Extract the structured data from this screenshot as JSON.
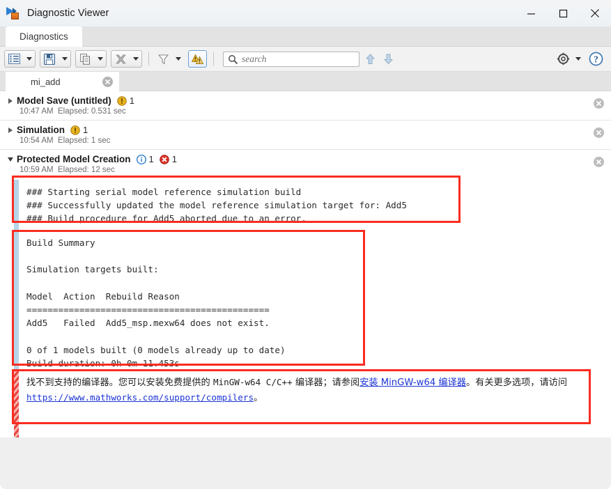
{
  "window": {
    "title": "Diagnostic Viewer",
    "controls": {
      "minimize": "—",
      "maximize": "□",
      "close": "✕"
    }
  },
  "tabs": {
    "main": "Diagnostics"
  },
  "toolbar": {
    "view_label": "view-options",
    "save_label": "save",
    "copy_label": "copy",
    "clear_label": "clear",
    "filter_label": "filter",
    "warnings_label": "warnings-errors",
    "settings_label": "settings",
    "help_label": "help",
    "search_placeholder": "search",
    "search_value": "",
    "prev_label": "previous-match",
    "next_label": "next-match"
  },
  "subtab": {
    "label": "mi_add",
    "close": "close"
  },
  "entries": [
    {
      "title": "Model Save (untitled)",
      "badges": [
        {
          "type": "warning",
          "count": "1"
        }
      ],
      "time": "10:47 AM",
      "elapsed": "Elapsed: 0.531 sec",
      "expanded": false
    },
    {
      "title": "Simulation",
      "badges": [
        {
          "type": "warning",
          "count": "1"
        }
      ],
      "time": "10:54 AM",
      "elapsed": "Elapsed: 1 sec",
      "expanded": false
    },
    {
      "title": "Protected Model Creation",
      "badges": [
        {
          "type": "info",
          "count": "1"
        },
        {
          "type": "error",
          "count": "1"
        }
      ],
      "time": "10:59 AM",
      "elapsed": "Elapsed: 12 sec",
      "expanded": true
    }
  ],
  "messages": {
    "build_log": "### Starting serial model reference simulation build\n### Successfully updated the model reference simulation target for: Add5\n### Build procedure for Add5 aborted due to an error.",
    "build_summary": "Build Summary\n\nSimulation targets built:\n\nModel  Action  Rebuild Reason\n==============================================\nAdd5   Failed  Add5_msp.mexw64 does not exist.\n\n0 of 1 models built (0 models already up to date)\nBuild duration: 0h 0m 11.453s",
    "error": {
      "part1": "找不到支持的编译器。您可以安装免费提供的 ",
      "mono1": "MinGW-w64 C/C++",
      "part2": " 编译器；请参阅",
      "link_cjk": "安装 MinGW-w64 编译器",
      "part3": "。有关更多选项，请访问 ",
      "link_url": "https://www.mathworks.com/support/compilers",
      "part4": "。"
    }
  },
  "colors": {
    "accent_red": "#fb2c21",
    "info_bar": "#b7d5e8",
    "link": "#1b34d4",
    "warning_icon": "#e8b21e",
    "error_icon": "#e03127",
    "info_icon": "#2e7fd1"
  }
}
